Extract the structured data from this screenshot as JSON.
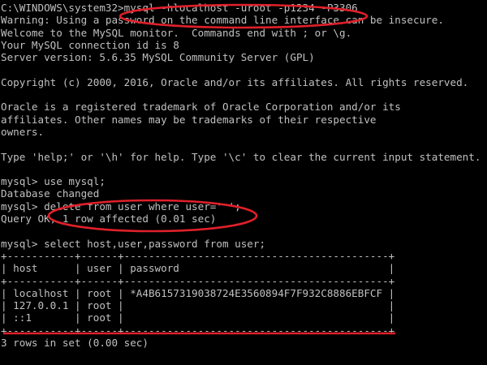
{
  "console": {
    "lines": [
      "C:\\WINDOWS\\system32>mysql -hlocalhost -uroot -p1234 -P3306",
      "Warning: Using a password on the command line interface can be insecure.",
      "Welcome to the MySQL monitor.  Commands end with ; or \\g.",
      "Your MySQL connection id is 8",
      "Server version: 5.6.35 MySQL Community Server (GPL)",
      "",
      "Copyright (c) 2000, 2016, Oracle and/or its affiliates. All rights reserved.",
      "",
      "Oracle is a registered trademark of Oracle Corporation and/or its",
      "affiliates. Other names may be trademarks of their respective",
      "owners.",
      "",
      "Type 'help;' or '\\h' for help. Type '\\c' to clear the current input statement.",
      "",
      "mysql> use mysql;",
      "Database changed",
      "mysql> delete from user where user=' ';",
      "Query OK, 1 row affected (0.01 sec)",
      "",
      "mysql> select host,user,password from user;",
      "+-----------+------+-------------------------------------------+",
      "| host      | user | password                                  |",
      "+-----------+------+-------------------------------------------+",
      "| localhost | root | *A4B6157319038724E3560894F7F932C8886EBFCF |",
      "| 127.0.0.1 | root |                                           |",
      "| ::1       | root |                                           |",
      "+-----------+------+-------------------------------------------+",
      "3 rows in set (0.00 sec)"
    ]
  },
  "colors": {
    "background": "#000000",
    "text": "#c0c0c0",
    "highlight": "#e0202a"
  }
}
